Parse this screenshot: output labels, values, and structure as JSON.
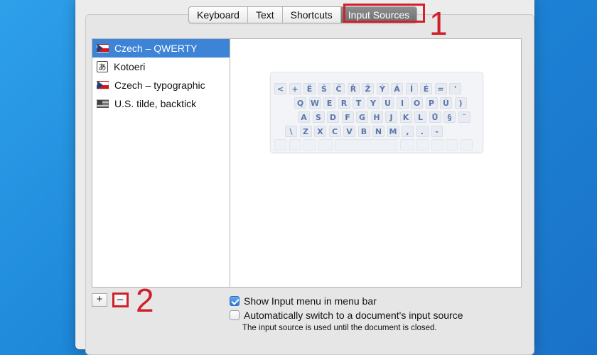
{
  "tabs": [
    {
      "label": "Keyboard",
      "selected": false
    },
    {
      "label": "Text",
      "selected": false
    },
    {
      "label": "Shortcuts",
      "selected": false
    },
    {
      "label": "Input Sources",
      "selected": true
    }
  ],
  "annotations": {
    "marker_1": "1",
    "marker_2": "2",
    "highlight_color": "#d0202a"
  },
  "input_sources": [
    {
      "label": "Czech – QWERTY",
      "icon": "czech-flag-icon",
      "selected": true
    },
    {
      "label": "Kotoeri",
      "icon": "kana-icon",
      "glyph": "あ",
      "selected": false
    },
    {
      "label": "Czech – typographic",
      "icon": "czech-flag-icon",
      "selected": false
    },
    {
      "label": "U.S. tilde, backtick",
      "icon": "us-flag-icon",
      "selected": false
    }
  ],
  "keyboard_rows": [
    [
      "<",
      "+",
      "Ě",
      "Š",
      "Č",
      "Ř",
      "Ž",
      "Ý",
      "Á",
      "Í",
      "É",
      "=",
      "'"
    ],
    [
      "Q",
      "W",
      "E",
      "R",
      "T",
      "Y",
      "U",
      "I",
      "O",
      "P",
      "Ú",
      ")"
    ],
    [
      "A",
      "S",
      "D",
      "F",
      "G",
      "H",
      "J",
      "K",
      "L",
      "Ů",
      "§",
      "¨"
    ],
    [
      "\\",
      "Z",
      "X",
      "C",
      "V",
      "B",
      "N",
      "M",
      ",",
      ".",
      "-"
    ]
  ],
  "buttons": {
    "add": "+",
    "remove": "–"
  },
  "options": {
    "show_input_menu": {
      "label": "Show Input menu in menu bar",
      "checked": true
    },
    "auto_switch": {
      "label": "Automatically switch to a document's input source",
      "checked": false
    },
    "note": "The input source is used until the document is closed."
  },
  "colors": {
    "selection": "#3d83d6",
    "key_text": "#5b78aa"
  }
}
